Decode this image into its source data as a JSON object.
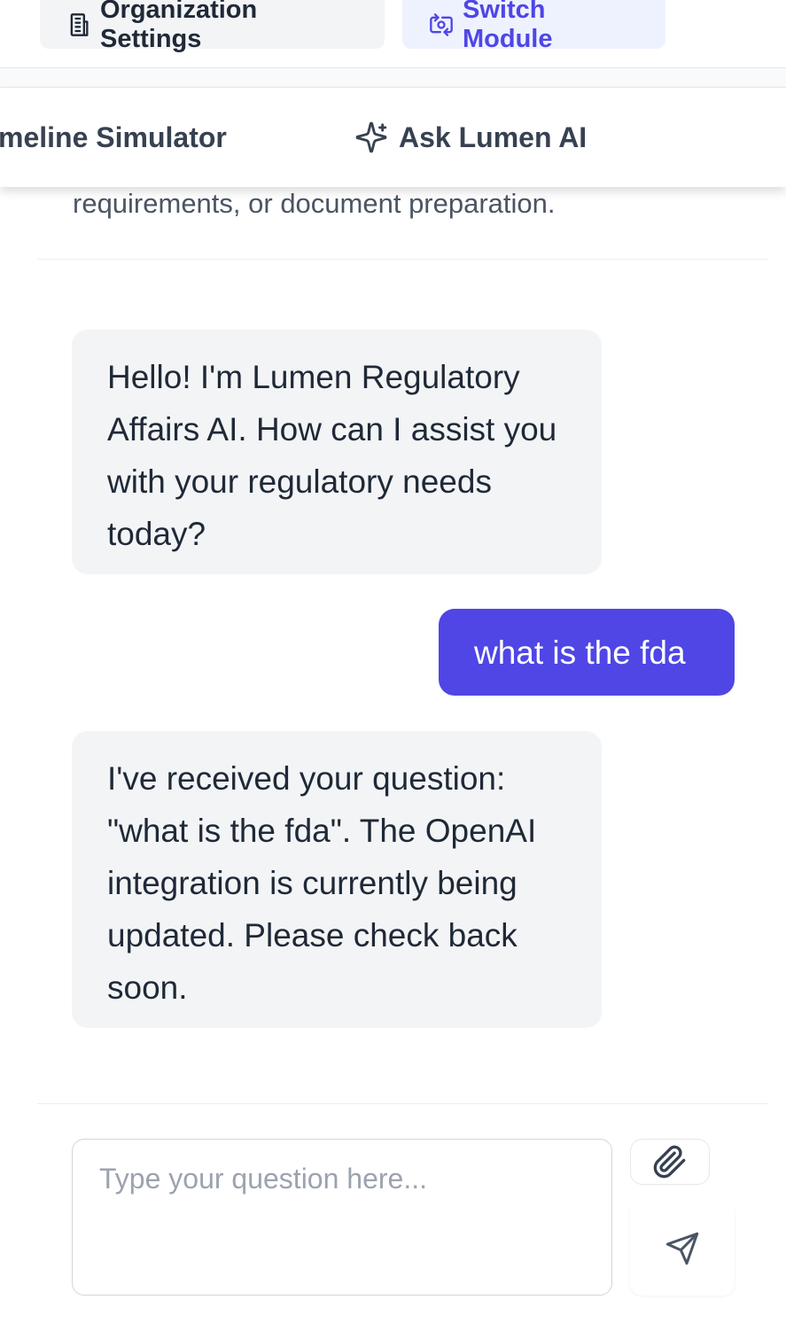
{
  "header": {
    "org_settings_label": "Organization Settings",
    "switch_module_label": "Switch Module",
    "org_icon": "building-icon",
    "switch_icon": "switch-camera-icon"
  },
  "tabs": [
    {
      "label": "meline Simulator"
    },
    {
      "label": "Ask Lumen AI",
      "icon": "sparkles-icon"
    }
  ],
  "chat": {
    "intro_tail": "requirements, or document preparation.",
    "messages": [
      {
        "role": "assistant",
        "text": "Hello! I'm Lumen Regulatory Affairs AI. How can I assist you with your regulatory needs today?"
      },
      {
        "role": "user",
        "text": "what is the fda"
      },
      {
        "role": "assistant",
        "text": "I've received your question: \"what is the fda\". The OpenAI integration is currently being updated. Please check back soon."
      }
    ]
  },
  "composer": {
    "placeholder": "Type your question here...",
    "value": "",
    "attach_icon": "paperclip-icon",
    "send_icon": "send-icon"
  },
  "colors": {
    "accent": "#4f46e5",
    "accent_light": "#eef2ff",
    "bubble_gray": "#f3f4f6"
  }
}
